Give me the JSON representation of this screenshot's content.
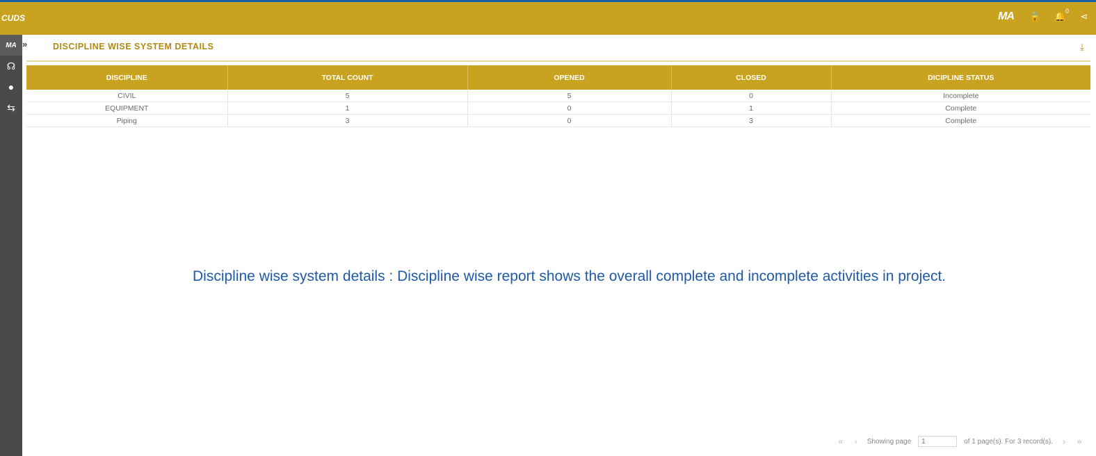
{
  "app": {
    "logo_text": "CUDS",
    "user_badge": "MA"
  },
  "topbar": {
    "icons": [
      "lock-icon",
      "bell-icon",
      "share-icon"
    ],
    "notification_count": "0",
    "lock_glyph": "🔒",
    "bell_glyph": "🔔",
    "share_glyph": "⋖"
  },
  "sidebar": {
    "expand_glyph": "»",
    "items": [
      {
        "name": "user-badge",
        "label": "MA"
      },
      {
        "name": "headset-icon",
        "glyph": "☊"
      },
      {
        "name": "user-icon",
        "glyph": "●"
      },
      {
        "name": "swap-icon",
        "glyph": "⇆"
      }
    ]
  },
  "page": {
    "title": "DISCIPLINE WISE SYSTEM DETAILS",
    "download_glyph": "⤓"
  },
  "table": {
    "headers": [
      "DISCIPLINE",
      "TOTAL COUNT",
      "OPENED",
      "CLOSED",
      "DICIPLINE STATUS"
    ],
    "rows": [
      [
        "CIVIL",
        "5",
        "5",
        "0",
        "Incomplete"
      ],
      [
        "EQUIPMENT",
        "1",
        "0",
        "1",
        "Complete"
      ],
      [
        "Piping",
        "3",
        "0",
        "3",
        "Complete"
      ]
    ]
  },
  "caption": {
    "text": "Discipline wise system details : Discipline wise report shows the overall complete and incomplete activities in project."
  },
  "pager": {
    "first_glyph": "«",
    "prev_glyph": "‹",
    "next_glyph": "›",
    "last_glyph": "»",
    "showing_label": "Showing page",
    "page_value": "1",
    "summary": "of 1 page(s). For 3 record(s)."
  }
}
